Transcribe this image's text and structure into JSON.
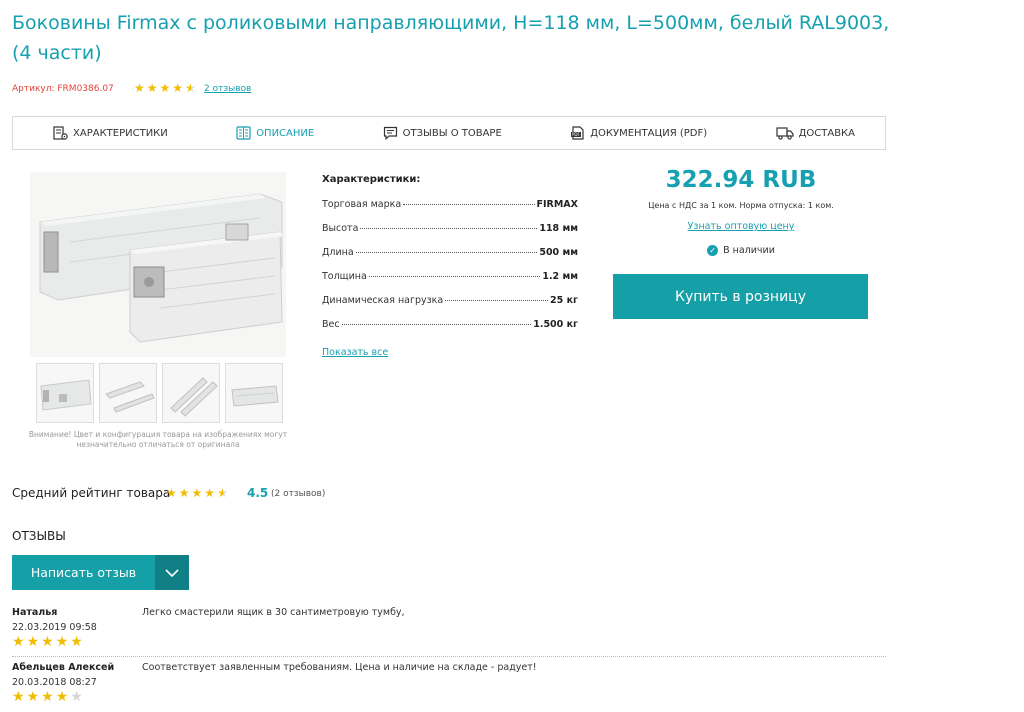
{
  "product": {
    "title": "Боковины Firmax с роликовыми направляющими, H=118 мм, L=500мм, белый RAL9003, (4 части)",
    "sku": "Артикул: FRM0386.07",
    "rating_stars": 4.5,
    "reviews_link": "2 отзывов"
  },
  "tabs": [
    {
      "label": "Характеристики",
      "icon": "gear-doc-icon"
    },
    {
      "label": "Описание",
      "icon": "document-list-icon"
    },
    {
      "label": "Отзывы о товаре",
      "icon": "comment-icon"
    },
    {
      "label": "Документация (PDF)",
      "icon": "pdf-icon"
    },
    {
      "label": "Доставка",
      "icon": "truck-icon"
    }
  ],
  "gallery": {
    "note": "Внимание! Цвет и конфигурация товара на изображениях могут незначительно отличаться от оригинала"
  },
  "specs": {
    "title": "Характеристики:",
    "rows": [
      {
        "name": "Торговая марка",
        "value": "FIRMAX"
      },
      {
        "name": "Высота",
        "value": "118 мм"
      },
      {
        "name": "Длина",
        "value": "500 мм"
      },
      {
        "name": "Толщина",
        "value": "1.2 мм"
      },
      {
        "name": "Динамическая нагрузка",
        "value": "25 кг"
      },
      {
        "name": "Вес",
        "value": "1.500 кг"
      }
    ],
    "show_all": "Показать все"
  },
  "purchase": {
    "price": "322.94 RUB",
    "price_note": "Цена с НДС за 1 ком. Норма отпуска: 1 ком.",
    "wholesale_link": "Узнать оптовую цену",
    "stock": "В наличии",
    "buy_button": "Купить в розницу"
  },
  "rating": {
    "label": "Средний рейтинг товара",
    "stars": 4.5,
    "value": "4.5",
    "count": "(2 отзывов)"
  },
  "reviews": {
    "heading": "ОТЗЫВЫ",
    "write_button": "Написать отзыв",
    "items": [
      {
        "author": "Наталья",
        "date": "22.03.2019 09:58",
        "stars": 5,
        "text": "Легко смастерили ящик в 30 сантиметровую тумбу,"
      },
      {
        "author": "Абельцев Алексей",
        "date": "20.03.2018 08:27",
        "stars": 4,
        "text": "Соответствует заявленным требованиям. Цена и наличие на складе - радует!"
      }
    ]
  },
  "colors": {
    "accent": "#17a0b0",
    "button": "#159fa6",
    "sku_red": "#e0443a",
    "star": "#f0be00"
  }
}
